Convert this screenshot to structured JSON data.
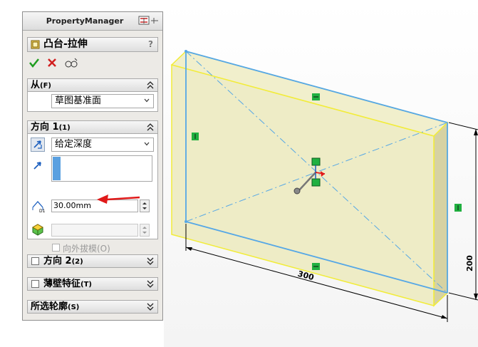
{
  "panel": {
    "title": "PropertyManager",
    "feature_title": "凸台-拉伸",
    "help": "?"
  },
  "from": {
    "label": "从",
    "shortcut": "(F)",
    "value": "草图基准面"
  },
  "direction1": {
    "label": "方向 1",
    "shortcut": "(1)",
    "end_condition": "给定深度",
    "depth": "30.00mm",
    "draft_label": "向外拔模(O)"
  },
  "direction2": {
    "label": "方向 2",
    "shortcut": "(2)"
  },
  "thin": {
    "label": "薄壁特征",
    "shortcut": "(T)"
  },
  "contours": {
    "label": "所选轮廓",
    "shortcut": "(S)"
  },
  "viewport": {
    "dim_width": "300",
    "dim_height": "200"
  },
  "colors": {
    "face": "#eeecc6",
    "edge_selected": "#55a7e6",
    "edge_highlight": "#f2ec3a",
    "confirm": "#1f9d1f",
    "cancel": "#d11f1f",
    "callout_arrow": "#e01919"
  }
}
